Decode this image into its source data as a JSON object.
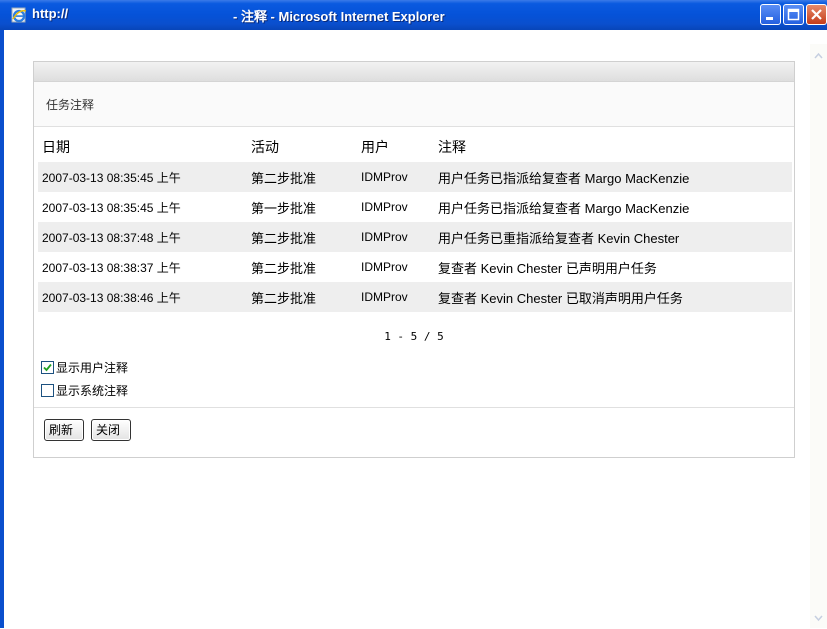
{
  "window": {
    "url": "http://",
    "title": "- 注释 - Microsoft Internet Explorer"
  },
  "panel": {
    "title": "任务注释"
  },
  "table": {
    "columns": [
      "日期",
      "活动",
      "用户",
      "注释"
    ],
    "rows": [
      {
        "date": "2007-03-13 08:35:45 上午",
        "activity": "第二步批准",
        "user": "IDMProv",
        "comment": "用户任务已指派给复查者 Margo MacKenzie"
      },
      {
        "date": "2007-03-13 08:35:45 上午",
        "activity": "第一步批准",
        "user": "IDMProv",
        "comment": "用户任务已指派给复查者 Margo MacKenzie"
      },
      {
        "date": "2007-03-13 08:37:48 上午",
        "activity": "第二步批准",
        "user": "IDMProv",
        "comment": "用户任务已重指派给复查者 Kevin Chester"
      },
      {
        "date": "2007-03-13 08:38:37 上午",
        "activity": "第二步批准",
        "user": "IDMProv",
        "comment": "复查者 Kevin Chester 已声明用户任务"
      },
      {
        "date": "2007-03-13 08:38:46 上午",
        "activity": "第二步批准",
        "user": "IDMProv",
        "comment": "复查者 Kevin Chester 已取消声明用户任务"
      }
    ]
  },
  "pager": "1 - 5 / 5",
  "options": {
    "show_user": {
      "label": "显示用户注释",
      "checked": true
    },
    "show_system": {
      "label": "显示系统注释",
      "checked": false
    }
  },
  "buttons": {
    "refresh": "刷新",
    "close": "关闭"
  },
  "colors": {
    "titlebar": "#0552d8",
    "row_shade": "#eeeeee"
  }
}
